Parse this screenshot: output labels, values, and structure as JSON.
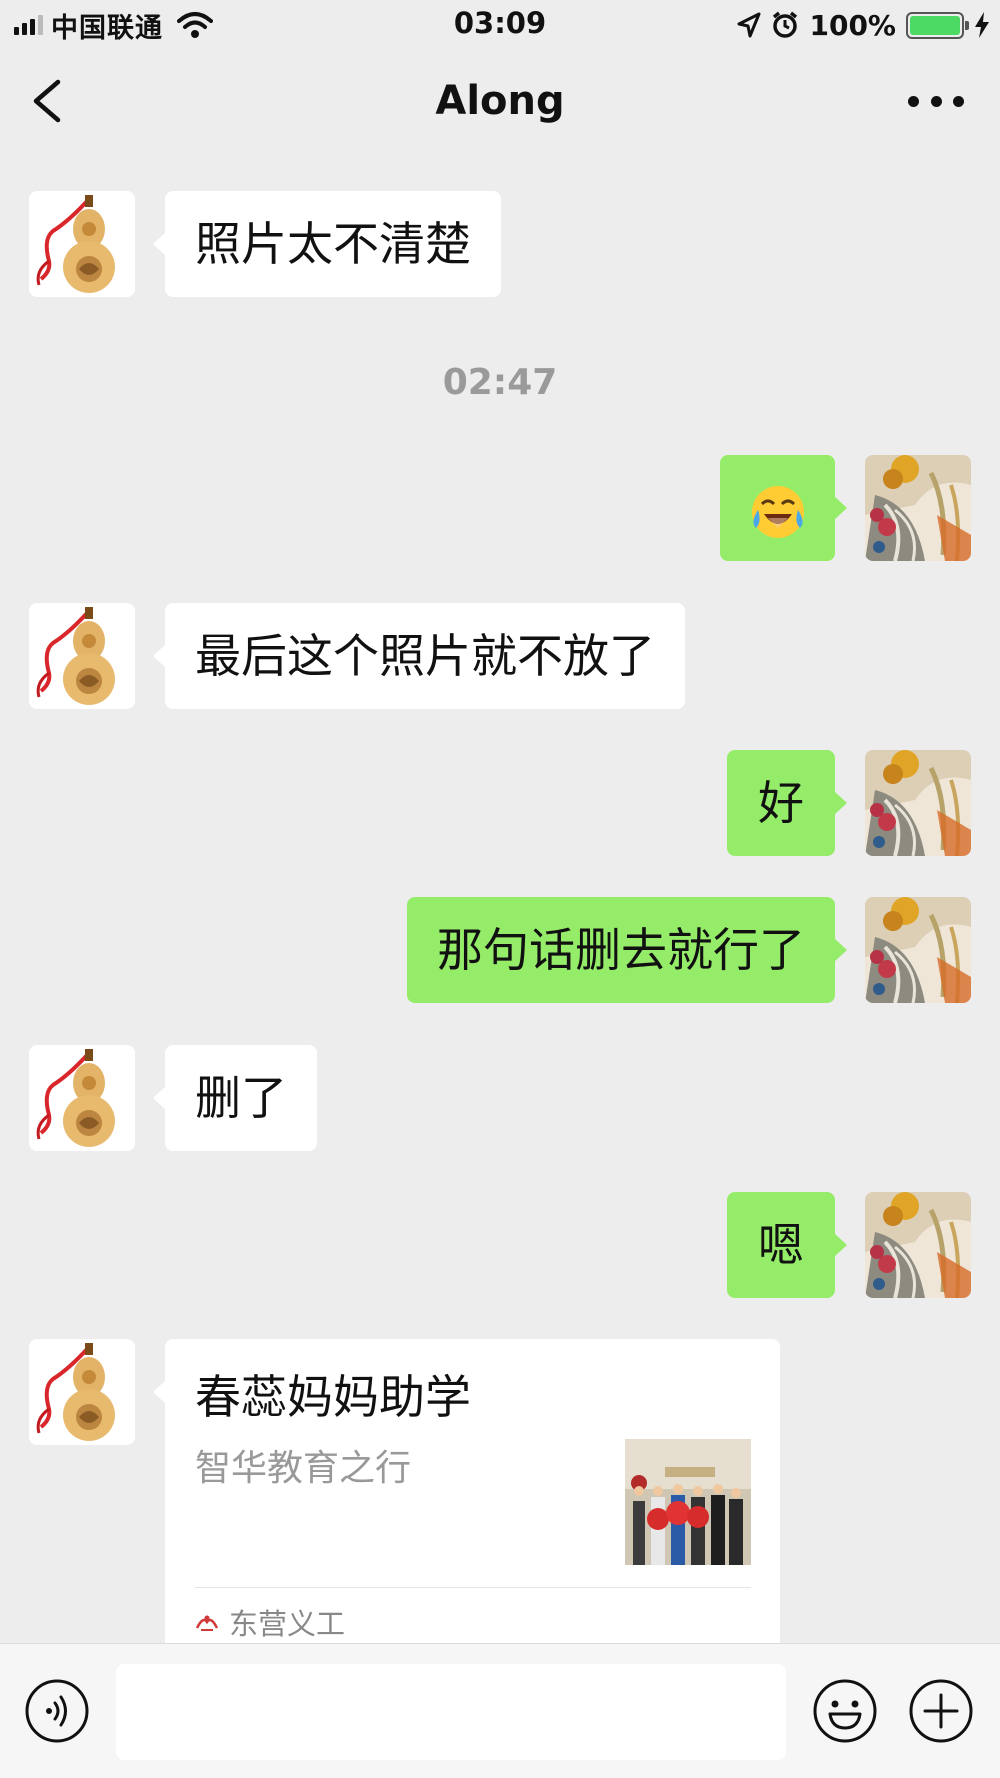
{
  "status_bar": {
    "carrier": "中国联通",
    "time": "03:09",
    "battery_percent": "100%",
    "icons": [
      "signal-icon",
      "wifi-icon",
      "location-icon",
      "alarm-icon",
      "battery-icon",
      "charging-icon"
    ]
  },
  "nav": {
    "title": "Along",
    "back_icon": "chevron-left-icon",
    "more_icon": "more-dots-icon"
  },
  "messages": [
    {
      "direction": "in",
      "type": "text",
      "text": "照片太不清楚"
    },
    {
      "direction": "system",
      "type": "timestamp",
      "text": "02:47"
    },
    {
      "direction": "out",
      "type": "emoji",
      "text": "😭",
      "icon": "crying-laughing-emoji-icon"
    },
    {
      "direction": "in",
      "type": "text",
      "text": "最后这个照片就不放了"
    },
    {
      "direction": "out",
      "type": "text",
      "text": "好"
    },
    {
      "direction": "out",
      "type": "text",
      "text": "那句话删去就行了"
    },
    {
      "direction": "in",
      "type": "text",
      "text": "删了"
    },
    {
      "direction": "out",
      "type": "text",
      "text": "嗯"
    },
    {
      "direction": "in",
      "type": "link",
      "title": "春蕊妈妈助学",
      "description": "智华教育之行",
      "source": "东营义工"
    }
  ],
  "input_bar": {
    "placeholder": "",
    "icons": [
      "voice-icon",
      "emoji-icon",
      "plus-icon"
    ]
  },
  "colors": {
    "background": "#ededed",
    "incoming_bubble": "#ffffff",
    "outgoing_bubble": "#95ec69",
    "timestamp_text": "#9a9a9a",
    "battery_fill": "#4cd964"
  }
}
